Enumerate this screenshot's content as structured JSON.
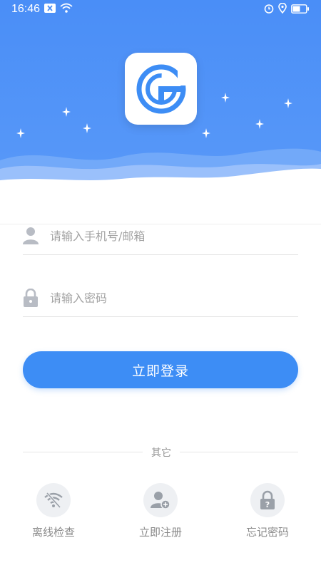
{
  "status_bar": {
    "time": "16:46",
    "left_icons": [
      "notification-x-icon",
      "wifi-icon"
    ],
    "right_icons": [
      "alarm-icon",
      "location-icon",
      "battery-icon"
    ]
  },
  "header": {
    "logo": "app-logo-g",
    "background_color": "#4a8ef7"
  },
  "form": {
    "account": {
      "placeholder": "请输入手机号/邮箱",
      "value": "",
      "icon": "user-icon"
    },
    "password": {
      "placeholder": "请输入密码",
      "value": "",
      "icon": "lock-icon"
    },
    "login_button": "立即登录"
  },
  "other": {
    "label": "其它",
    "actions": [
      {
        "label": "离线检查",
        "icon": "wifi-off-icon"
      },
      {
        "label": "立即注册",
        "icon": "user-add-icon"
      },
      {
        "label": "忘记密码",
        "icon": "question-lock-icon"
      }
    ]
  },
  "colors": {
    "accent": "#3d8df5",
    "icon_gray": "#9aa0a8"
  }
}
